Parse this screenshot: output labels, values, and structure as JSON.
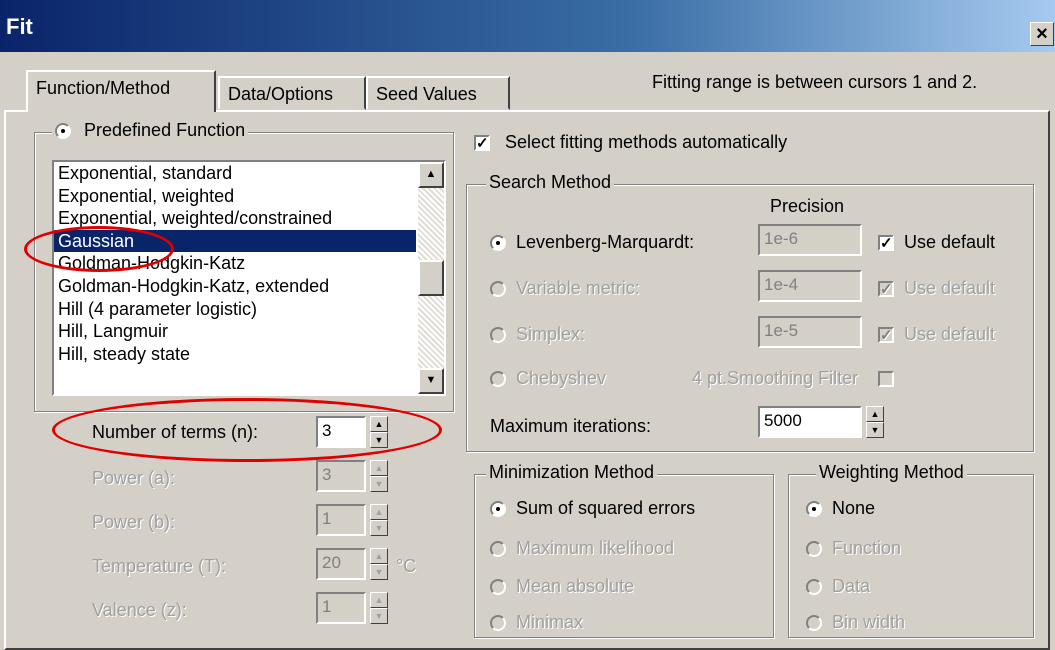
{
  "window": {
    "title": "Fit",
    "close_glyph": "×"
  },
  "tabs": [
    "Function/Method",
    "Data/Options",
    "Seed Values"
  ],
  "hint": "Fitting range is between cursors 1 and 2.",
  "predefined": {
    "label": "Predefined Function",
    "functions": [
      "Exponential, standard",
      "Exponential, weighted",
      "Exponential, weighted/constrained",
      "Gaussian",
      "Goldman-Hodgkin-Katz",
      "Goldman-Hodgkin-Katz, extended",
      "Hill (4 parameter logistic)",
      "Hill, Langmuir",
      "Hill, steady state"
    ],
    "selected": "Gaussian"
  },
  "params": {
    "terms_label": "Number of terms (n):",
    "terms_value": "3",
    "power_a_label": "Power (a):",
    "power_a_value": "3",
    "power_b_label": "Power (b):",
    "power_b_value": "1",
    "temp_label": "Temperature (T):",
    "temp_value": "20",
    "temp_unit": "°C",
    "valence_label": "Valence (z):",
    "valence_value": "1"
  },
  "auto_select": {
    "label": "Select fitting methods automatically",
    "checked": true
  },
  "search": {
    "title": "Search Method",
    "precision_header": "Precision",
    "lm": {
      "label": "Levenberg-Marquardt:",
      "precision": "1e-6",
      "use_default": "Use default"
    },
    "vm": {
      "label": "Variable metric:",
      "precision": "1e-4",
      "use_default": "Use default"
    },
    "simplex": {
      "label": "Simplex:",
      "precision": "1e-5",
      "use_default": "Use default"
    },
    "cheb": {
      "label": "Chebyshev",
      "filter": "4 pt.Smoothing Filter"
    },
    "max_iter_label": "Maximum iterations:",
    "max_iter_value": "5000"
  },
  "minimization": {
    "title": "Minimization Method",
    "options": [
      "Sum of squared errors",
      "Maximum likelihood",
      "Mean absolute",
      "Minimax"
    ]
  },
  "weighting": {
    "title": "Weighting Method",
    "options": [
      "None",
      "Function",
      "Data",
      "Bin width"
    ]
  },
  "icons": {
    "up": "▲",
    "down": "▼",
    "check": "✓"
  },
  "annotation_color": "#e00000"
}
